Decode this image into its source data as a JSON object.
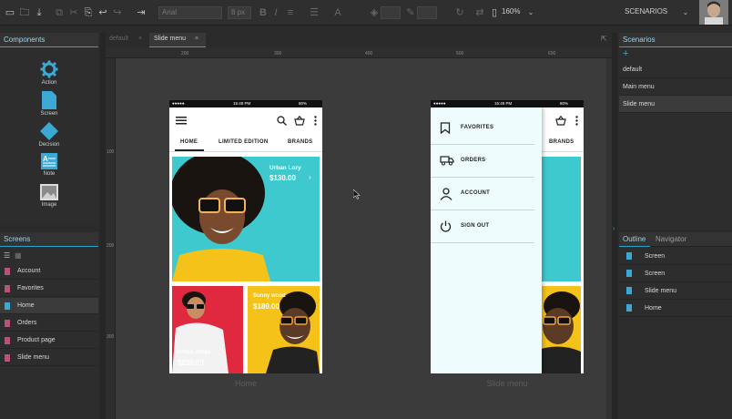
{
  "toolbar": {
    "font_field": "Arial",
    "size_field": "8 px",
    "zoom": "160%",
    "scenarios_label": "SCENARIOS"
  },
  "tabs": {
    "inactive": "default",
    "active": "Slide menu"
  },
  "components": {
    "title": "Components",
    "items": [
      {
        "label": "Action",
        "icon": "gear-icon"
      },
      {
        "label": "Screen",
        "icon": "screen-page-icon"
      },
      {
        "label": "Decision",
        "icon": "diamond-icon"
      },
      {
        "label": "Note",
        "icon": "note-icon"
      },
      {
        "label": "Image",
        "icon": "image-icon"
      }
    ]
  },
  "screens": {
    "title": "Screens",
    "items": [
      "Account",
      "Favorites",
      "Home",
      "Orders",
      "Product page",
      "Slide menu"
    ],
    "selected": "Home"
  },
  "scenarios": {
    "title": "Scenarios",
    "items": [
      "default",
      "Main menu",
      "Slide menu"
    ],
    "selected": "Slide menu"
  },
  "outline": {
    "tab_outline": "Outline",
    "tab_navigator": "Navigator",
    "items": [
      "Screen",
      "Screen",
      "Slide menu",
      "Home"
    ]
  },
  "ruler": {
    "h_labels": [
      "200",
      "300",
      "400",
      "500",
      "600"
    ],
    "v_labels": [
      "100",
      "200",
      "300"
    ]
  },
  "home_phone": {
    "status_time": "15:49 PM",
    "status_batt": "80%",
    "nav_tabs": [
      "HOME",
      "LIMITED EDITION",
      "BRANDS"
    ],
    "hero_name": "Urban Lory",
    "hero_price": "$130.00",
    "card2_name": "Sunny wood",
    "card2_price": "$180.00",
    "card1_name": "Urban Jones",
    "card1_price": "$230.00",
    "label": "Home"
  },
  "slide_phone": {
    "status_time": "15:49 PM",
    "status_batt": "80%",
    "nav_tab": "BRANDS",
    "menu": [
      "FAVORITES",
      "ORDERS",
      "ACCOUNT",
      "SIGN OUT"
    ],
    "label": "Slide menu"
  },
  "colors": {
    "accent": "#29b6d6",
    "teal": "#3ec9cf",
    "yellow": "#f5c21a",
    "red": "#e0283f",
    "menu_bg": "#eefcfd"
  }
}
